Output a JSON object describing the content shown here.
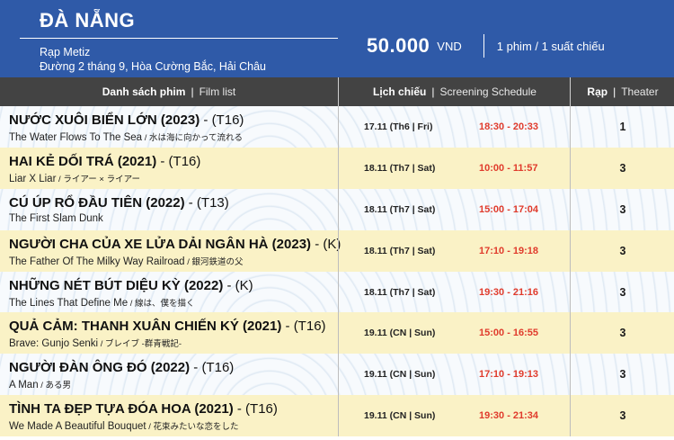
{
  "header": {
    "city": "ĐÀ NẴNG",
    "venue_name": "Rạp Metiz",
    "venue_address": "Đường 2 tháng 9, Hòa Cường Bắc, Hải Châu",
    "price": "50.000",
    "currency": "VND",
    "ticket_note": "1 phim / 1 suất chiếu",
    "color": "#2f5aa8"
  },
  "columns": {
    "film_vi": "Danh sách phim",
    "film_en": "Film list",
    "schedule_vi": "Lịch chiếu",
    "schedule_en": "Screening Schedule",
    "theater_vi": "Rạp",
    "theater_en": "Theater"
  },
  "films": [
    {
      "title": "NƯỚC XUÔI BIỂN LỚN (2023)",
      "rating": " - (T16)",
      "en": "The Water Flows To The Sea",
      "jp": " / 水は海に向かって流れる",
      "date": "17.11 (Th6 | Fri)",
      "time": "18:30 - 20:33",
      "theater": "1"
    },
    {
      "title": "HAI KẺ DỐI TRÁ (2021)",
      "rating": " - (T16)",
      "en": "Liar X Liar",
      "jp": " / ライアー × ライアー",
      "date": "18.11 (Th7 | Sat)",
      "time": "10:00 - 11:57",
      "theater": "3"
    },
    {
      "title": "CÚ ÚP RỔ ĐẦU TIÊN  (2022)",
      "rating": " - (T13)",
      "en": "The First Slam Dunk",
      "jp": "",
      "date": "18.11 (Th7 | Sat)",
      "time": "15:00 - 17:04",
      "theater": "3"
    },
    {
      "title": "NGƯỜI CHA CỦA XE LỬA DẢI NGÂN HÀ  (2023)",
      "rating": " - (K)",
      "en": "The Father Of The Milky Way Railroad",
      "jp": "  /  銀河鉄道の父",
      "date": "18.11 (Th7 | Sat)",
      "time": "17:10 - 19:18",
      "theater": "3"
    },
    {
      "title": "NHỮNG NÉT BÚT DIỆU KỲ (2022)",
      "rating": " - (K)",
      "en": "The Lines That Define Me",
      "jp": " / 線は、僕を描く",
      "date": "18.11 (Th7 | Sat)",
      "time": "19:30 - 21:16",
      "theater": "3"
    },
    {
      "title": "QUẢ CẢM: THANH XUÂN CHIẾN KÝ (2021)",
      "rating": " - (T16)",
      "en": "Brave: Gunjo Senki",
      "jp": " / ブレイブ -群青戦記-",
      "date": "19.11 (CN | Sun)",
      "time": "15:00 - 16:55",
      "theater": "3"
    },
    {
      "title": "NGƯỜI ĐÀN ÔNG ĐÓ (2022)",
      "rating": " - (T16)",
      "en": "A Man",
      "jp": " / ある男",
      "date": "19.11 (CN | Sun)",
      "time": "17:10 - 19:13",
      "theater": "3"
    },
    {
      "title": "TÌNH TA ĐẸP TỰA ĐÓA HOA (2021)",
      "rating": " - (T16)",
      "en": "We Made A Beautiful Bouquet",
      "jp": "  /  花束みたいな恋をした",
      "date": "19.11 (CN | Sun)",
      "time": "19:30 - 21:34",
      "theater": "3"
    }
  ]
}
